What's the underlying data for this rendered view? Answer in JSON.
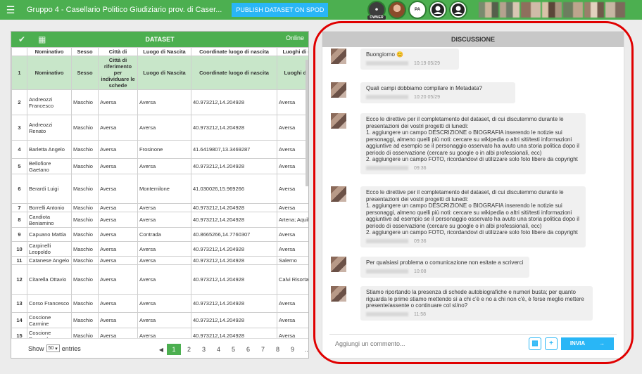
{
  "topbar": {
    "title": "Gruppo 4 - Casellario Politico Giudiziario prov. di Caser...",
    "publish_label": "PUBLISH DATASET ON SPOD",
    "owner_tag": "OWNER",
    "pa_tag": "PA"
  },
  "dataset": {
    "title": "DATASET",
    "status": "Online",
    "columns": [
      "Nominativo",
      "Sesso",
      "Città di",
      "Luogo di Nascita",
      "Coordinate luogo di nascita",
      "Luoghi di res"
    ],
    "header_row": {
      "n": "1",
      "cells": [
        "Nominativo",
        "Sesso",
        "Città di riferimento per individuare le schede",
        "Luogo di Nascita",
        "Coordinate luogo di nascita",
        "Luoghi di re"
      ]
    },
    "rows": [
      {
        "n": "2",
        "cells": [
          "Andreozzi Francesco",
          "Maschio",
          "Aversa",
          "Aversa",
          "40.973212,14.204928",
          "Aversa"
        ]
      },
      {
        "n": "3",
        "cells": [
          "Andreozzi Renato",
          "Maschio",
          "Aversa",
          "Aversa",
          "40.973212,14.204928",
          "Aversa"
        ]
      },
      {
        "n": "4",
        "cells": [
          "Barletta Angelo",
          "Maschio",
          "Aversa",
          "Frosinone",
          "41.6419807,13.3469287",
          "Aversa"
        ]
      },
      {
        "n": "5",
        "cells": [
          "Bellofiore Gaetano",
          "Maschio",
          "Aversa",
          "Aversa",
          "40.973212,14.204928",
          "Aversa"
        ]
      },
      {
        "n": "6",
        "cells": [
          "Berardi Luigi",
          "Maschio",
          "Aversa",
          "Montemilone",
          "41.030026,15.969266",
          "Aversa"
        ]
      },
      {
        "n": "7",
        "cells": [
          "Borrelli Antonio",
          "Maschio",
          "Aversa",
          "Aversa",
          "40.973212,14.204928",
          "Aversa"
        ]
      },
      {
        "n": "8",
        "cells": [
          "Candiota Beniamino",
          "Maschio",
          "Aversa",
          "Aversa",
          "40.973212,14.204928",
          "Artena; Aquil"
        ]
      },
      {
        "n": "9",
        "cells": [
          "Capuano Mattia",
          "Maschio",
          "Aversa",
          "Contrada",
          "40.8665266,14.7760307",
          "Aversa"
        ]
      },
      {
        "n": "10",
        "cells": [
          "Carpinelli Leopoldo",
          "Maschio",
          "Aversa",
          "Aversa",
          "40.973212,14.204928",
          "Aversa"
        ]
      },
      {
        "n": "11",
        "cells": [
          "Catanese Angelo",
          "Maschio",
          "Aversa",
          "Aversa",
          "40.973212,14.204928",
          "Salerno"
        ]
      },
      {
        "n": "12",
        "cells": [
          "Citarella Ottavio",
          "Maschio",
          "Aversa",
          "Aversa",
          "40.973212,14.204928",
          "Calvi Risorta"
        ]
      },
      {
        "n": "13",
        "cells": [
          "Corso Francesco",
          "Maschio",
          "Aversa",
          "Aversa",
          "40.973212,14.204928",
          "Aversa"
        ]
      },
      {
        "n": "14",
        "cells": [
          "Coscione Carmine",
          "Maschio",
          "Aversa",
          "Aversa",
          "40.973212,14.204928",
          "Aversa"
        ]
      },
      {
        "n": "15",
        "cells": [
          "Coscione Pasquale",
          "Maschio",
          "Aversa",
          "Aversa",
          "40.973212,14.204928",
          "Aversa"
        ]
      }
    ],
    "show_label": "Show",
    "entries_value": "50",
    "entries_label": "entries",
    "pages": [
      "1",
      "2",
      "3",
      "4",
      "5",
      "6",
      "7",
      "8",
      "9",
      "..."
    ]
  },
  "discussion": {
    "title": "DISCUSSIONE",
    "messages": [
      {
        "text": "Buongiorno 😊",
        "time": "10:19 05/29"
      },
      {
        "text": "Quali campi dobbiamo compilare in Metadata?",
        "time": "10:20 05/29"
      },
      {
        "text": "Ecco le direttive per il completamento del dataset, di cui discutemmo durante le presentazioni dei vostri progetti di lunedì:\n1. aggiungere un campo DESCRIZIONE o BIOGRAFIA inserendo le notizie sui personaggi, almeno quelli più noti: cercare su wikipedia o altri siti/testi informazioni aggiuntive ad esempio se il personaggio osservato ha avuto una storia politica dopo il periodo di osservazione (cercare su google o in albi professionali, ecc)\n2. aggiungere un campo FOTO, ricordandovi di utilizzare solo foto libere da copyright",
        "time": "09:36"
      },
      {
        "text": "Ecco le direttive per il completamento del dataset, di cui discutemmo durante le presentazioni dei vostri progetti di lunedì:\n1. aggiungere un campo DESCRIZIONE o BIOGRAFIA inserendo le notizie sui personaggi, almeno quelli più noti: cercare su wikipedia o altri siti/testi informazioni aggiuntive ad esempio se il personaggio osservato ha avuto una storia politica dopo il periodo di osservazione (cercare su google o in albi professionali, ecc)\n2. aggiungere un campo FOTO, ricordandovi di utilizzare solo foto libere da copyright",
        "time": "09:36"
      },
      {
        "text": "Per qualsiasi problema o comunicazione non esitate a scriverci",
        "time": "10:08"
      },
      {
        "text": "Stiamo riportando la presenza di schede autobiografiche e numeri busta; per quanto riguarda le prime stiamo mettendo sì a chi c'è e no a chi non c'è, è forse meglio mettere presente/assente o continuare col sì/no?",
        "time": "11:58"
      }
    ],
    "comment_placeholder": "Aggiungi un commento...",
    "send_label": "INVIA"
  },
  "colors": {
    "brand_green": "#4caf50",
    "accent_blue": "#29b6f6",
    "highlight_red": "#e00000"
  }
}
